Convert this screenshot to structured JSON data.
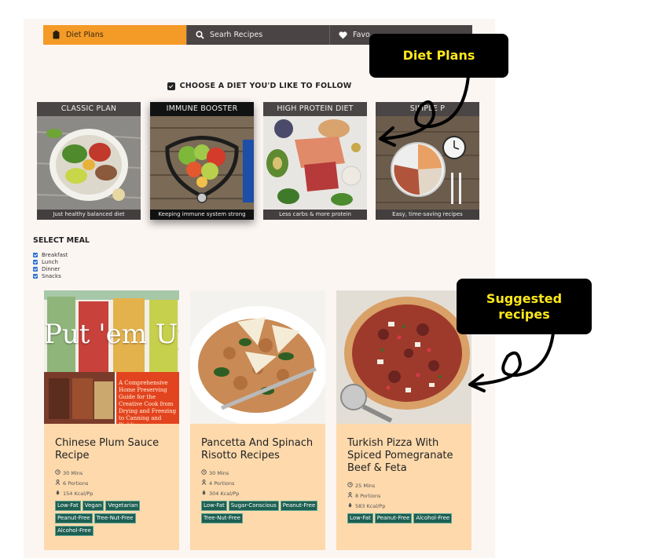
{
  "nav": {
    "tabs": [
      {
        "label": "Diet Plans",
        "icon": "clipboard-icon",
        "active": true
      },
      {
        "label": "Searh Recipes",
        "icon": "search-icon",
        "active": false
      },
      {
        "label": "Favo",
        "icon": "heart-icon",
        "active": false
      }
    ]
  },
  "choose_heading": "CHOOSE A DIET YOU'D LIKE TO FOLLOW",
  "plans": [
    {
      "title": "CLASSIC PLAN",
      "caption": "Just healthy balanced diet"
    },
    {
      "title": "IMMUNE BOOSTER",
      "caption": "Keeping immune system strong"
    },
    {
      "title": "HIGH PROTEIN DIET",
      "caption": "Less carbs & more protein"
    },
    {
      "title": "SIMPLE P",
      "caption": "Easy, time-saving recipes"
    }
  ],
  "select_meal": {
    "title": "SELECT MEAL",
    "options": [
      "Breakfast",
      "Lunch",
      "Dinner",
      "Snacks"
    ]
  },
  "recipes": [
    {
      "title": "Chinese Plum Sauce Recipe",
      "time": "30 Mins",
      "portions": "6 Portions",
      "kcal": "154 Kcal/Pp",
      "tags": [
        "Low-Fat",
        "Vegan",
        "Vegetarian",
        "Peanut-Free",
        "Tree-Nut-Free",
        "Alcohol-Free"
      ],
      "image_text": {
        "big": "Put 'em Up",
        "sub": "A Comprehensive Home Preserving Guide for the Creative Cook from Drying and Freezing to Canning and Pickling"
      }
    },
    {
      "title": "Pancetta And Spinach Risotto Recipes",
      "time": "30 Mins",
      "portions": "4 Portions",
      "kcal": "304 Kcal/Pp",
      "tags": [
        "Low-Fat",
        "Sugar-Conscious",
        "Peanut-Free",
        "Tree-Nut-Free"
      ]
    },
    {
      "title": "Turkish Pizza With Spiced Pomegranate Beef & Feta",
      "time": "25 Mins",
      "portions": "8 Portions",
      "kcal": "583 Kcal/Pp",
      "tags": [
        "Low-Fat",
        "Peanut-Free",
        "Alcohol-Free"
      ]
    }
  ],
  "annotations": {
    "diet_plans": "Diet Plans",
    "suggested_line1": "Suggested",
    "suggested_line2": "recipes"
  },
  "colors": {
    "accent": "#f49a27",
    "nav_dark": "#4a4444",
    "card_bg": "#fdd9ac",
    "tag_bg": "#1d5f52",
    "callout_text": "#ffe81a"
  }
}
